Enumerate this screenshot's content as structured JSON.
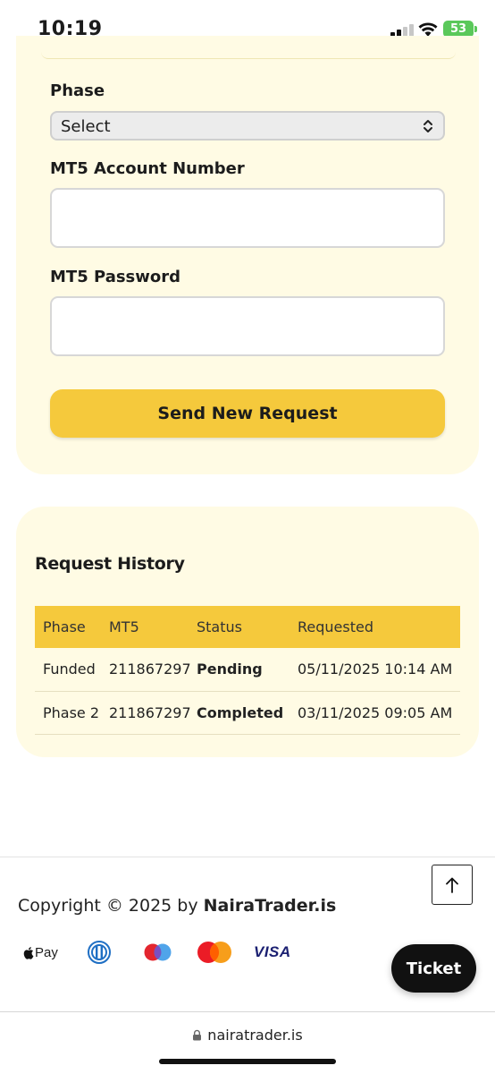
{
  "status_bar": {
    "time": "10:19",
    "battery": "53",
    "icons": [
      "signal-icon",
      "wifi-icon",
      "battery-charging-icon"
    ]
  },
  "form": {
    "phase_label": "Phase",
    "phase_select_value": "Select",
    "mt5_account_label": "MT5 Account Number",
    "mt5_account_value": "",
    "mt5_password_label": "MT5 Password",
    "mt5_password_value": "",
    "submit_label": "Send New Request"
  },
  "history": {
    "title": "Request History",
    "columns": [
      "Phase",
      "MT5",
      "Status",
      "Requested"
    ],
    "rows": [
      {
        "phase": "Funded",
        "mt5": "211867297",
        "status": "Pending",
        "requested": "05/11/2025 10:14 AM"
      },
      {
        "phase": "Phase 2",
        "mt5": "211867297",
        "status": "Completed",
        "requested": "03/11/2025 09:05 AM"
      }
    ]
  },
  "footer": {
    "copyright_prefix": "Copyright © 2025 by ",
    "copyright_brand": "NairaTrader.is",
    "payment_methods": [
      "Pay",
      "diners-club-icon",
      "maestro-icon",
      "mastercard-icon",
      "VISA"
    ],
    "ticket_label": "Ticket"
  },
  "browser": {
    "url": "nairatrader.is"
  },
  "colors": {
    "accent": "#f5c93c",
    "card_bg": "#fffbe4",
    "pending": "#f0a53a",
    "completed": "#4aa04a"
  }
}
